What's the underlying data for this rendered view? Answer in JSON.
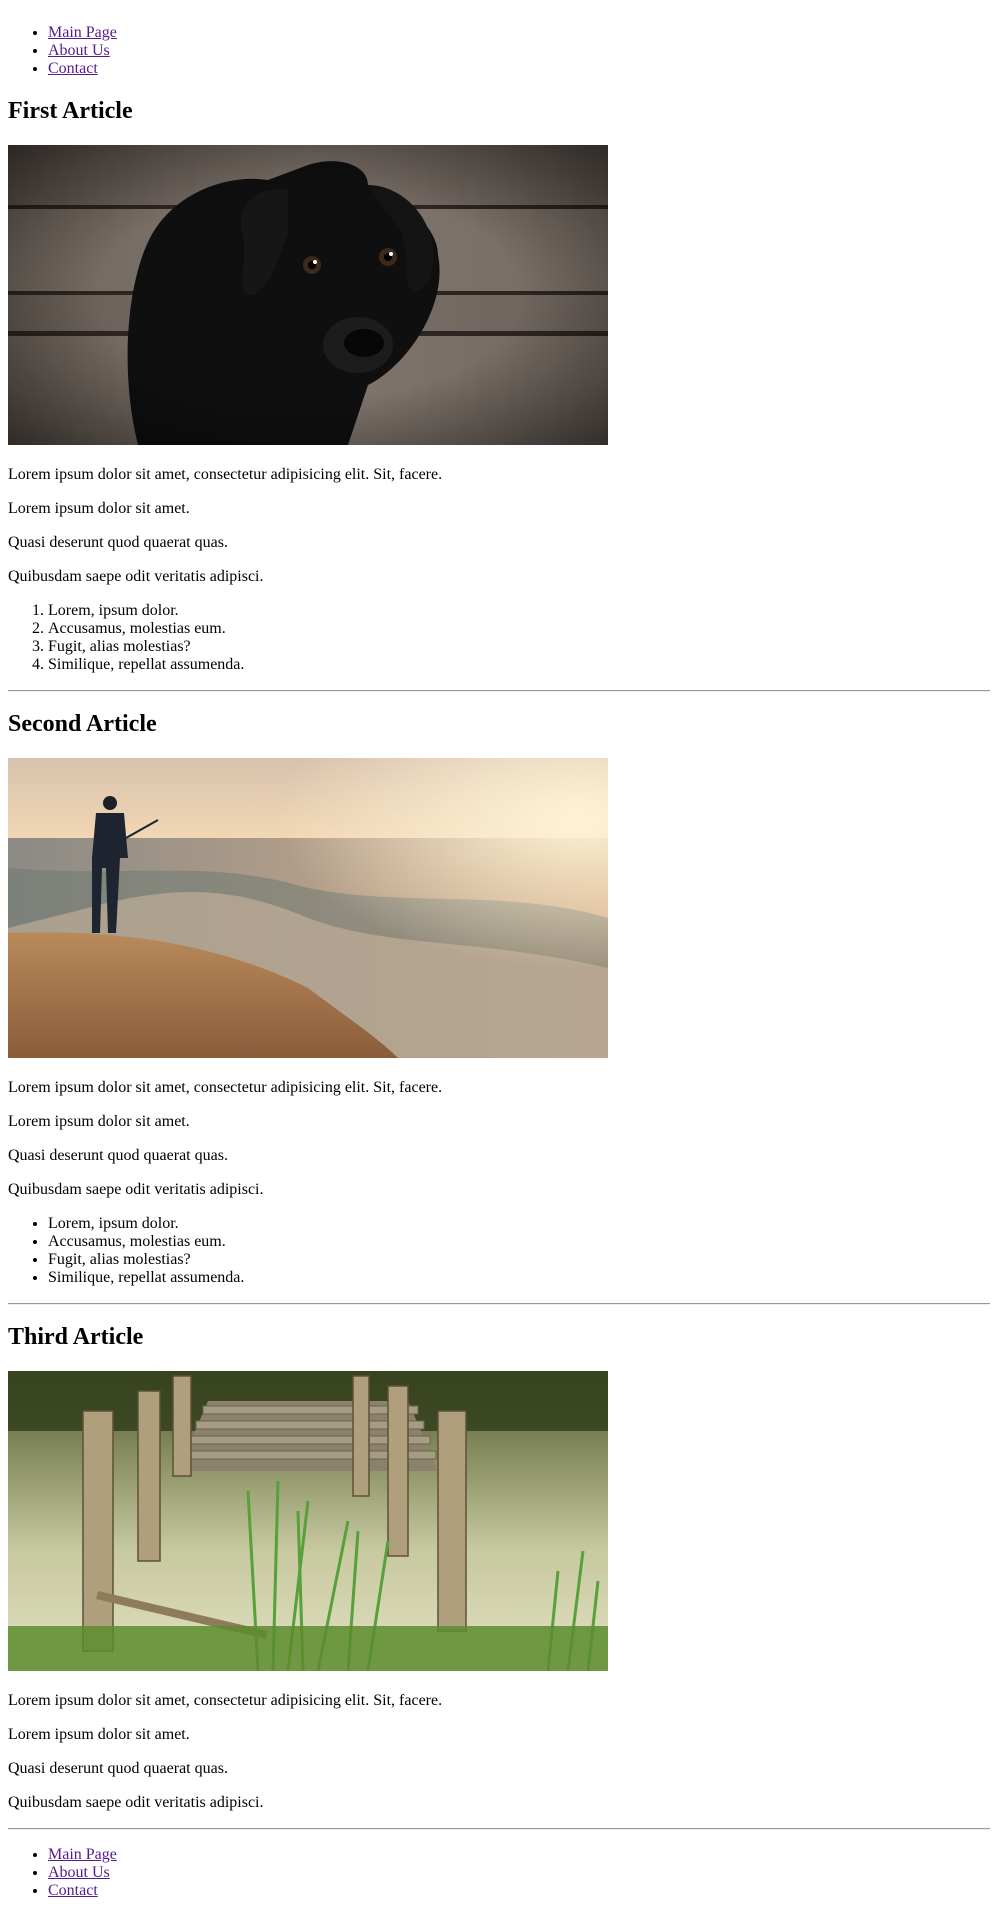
{
  "nav": {
    "top": [
      "Main Page",
      "About Us",
      "Contact"
    ],
    "bottom": [
      "Main Page",
      "About Us",
      "Contact"
    ],
    "link_color": "#551a8b"
  },
  "articles": [
    {
      "title": "First Article",
      "image": "dog-photo",
      "paragraphs": [
        "Lorem ipsum dolor sit amet, consectetur adipisicing elit. Sit, facere.",
        "Lorem ipsum dolor sit amet.",
        "Quasi deserunt quod quaerat quas.",
        "Quibusdam saepe odit veritatis adipisci."
      ],
      "list_type": "ordered",
      "list": [
        "Lorem, ipsum dolor.",
        "Accusamus, molestias eum.",
        "Fugit, alias molestias?",
        "Similique, repellat assumenda."
      ]
    },
    {
      "title": "Second Article",
      "image": "fisherman-photo",
      "paragraphs": [
        "Lorem ipsum dolor sit amet, consectetur adipisicing elit. Sit, facere.",
        "Lorem ipsum dolor sit amet.",
        "Quasi deserunt quod quaerat quas.",
        "Quibusdam saepe odit veritatis adipisci."
      ],
      "list_type": "unordered",
      "list": [
        "Lorem, ipsum dolor.",
        "Accusamus, molestias eum.",
        "Fugit, alias molestias?",
        "Similique, repellat assumenda."
      ]
    },
    {
      "title": "Third Article",
      "image": "pier-photo",
      "paragraphs": [
        "Lorem ipsum dolor sit amet, consectetur adipisicing elit. Sit, facere.",
        "Lorem ipsum dolor sit amet.",
        "Quasi deserunt quod quaerat quas.",
        "Quibusdam saepe odit veritatis adipisci."
      ]
    }
  ]
}
